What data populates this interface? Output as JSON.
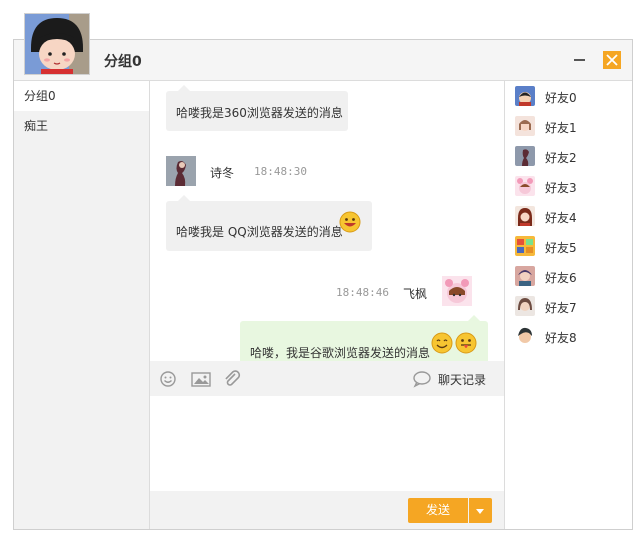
{
  "header": {
    "group_title": "分组0",
    "minimize_icon": "minimize-icon",
    "close_icon": "close-icon",
    "accent_color": "#f5a623"
  },
  "groups": [
    {
      "label": "分组0",
      "active": true
    },
    {
      "label": "痴王",
      "active": false
    }
  ],
  "messages": [
    {
      "text": "哈喽我是360浏览器发送的消息",
      "self": false
    },
    {
      "sender": "诗冬",
      "time": "18:48:30",
      "text": "哈喽我是 QQ浏览器发送的消息",
      "emoji": [
        "grin-emoji"
      ],
      "self": false
    },
    {
      "sender": "飞枫",
      "time": "18:48:46",
      "text": "哈喽，我是谷歌浏览器发送的消息",
      "emoji": [
        "smile-emoji",
        "tongue-emoji"
      ],
      "self": true
    }
  ],
  "toolbar": {
    "icons": [
      "emoji-icon",
      "image-icon",
      "attachment-icon"
    ],
    "history_label": "聊天记录",
    "history_icon": "chat-bubble-icon"
  },
  "send": {
    "label": "发送"
  },
  "friends": [
    {
      "name": "好友0"
    },
    {
      "name": "好友1"
    },
    {
      "name": "好友2"
    },
    {
      "name": "好友3"
    },
    {
      "name": "好友4"
    },
    {
      "name": "好友5"
    },
    {
      "name": "好友6"
    },
    {
      "name": "好友7"
    },
    {
      "name": "好友8"
    }
  ]
}
